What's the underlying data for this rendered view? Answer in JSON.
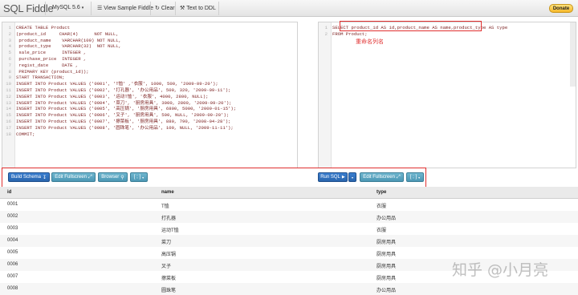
{
  "topbar": {
    "brand": "SQL Fiddle",
    "db_select": "MySQL 5.6",
    "view_sample": "View Sample Fiddle",
    "clear": "Clear",
    "text_to_ddl": "Text to DDL",
    "donate": "Donate"
  },
  "schema_lines": [
    "CREATE TABLE Product",
    "(product_id     CHAR(4)      NOT NULL,",
    " product_name    VARCHAR(100) NOT NULL,",
    " product_type    VARCHAR(32)  NOT NULL,",
    " sale_price      INTEGER ,",
    " purchase_price  INTEGER ,",
    " regist_date     DATE ,",
    " PRIMARY KEY (product_id));",
    "START TRANSACTION;",
    "INSERT INTO Product VALUES ('0001', 'T恤' ,'衣服', 1000, 500, '2009-09-20');",
    "INSERT INTO Product VALUES ('0002', '打孔器', '办公用品', 500, 320, '2009-09-11');",
    "INSERT INTO Product VALUES ('0003', '运动T恤', '衣服', 4000, 2800, NULL);",
    "INSERT INTO Product VALUES ('0004', '菜刀', '厨房用具', 3000, 2800, '2009-09-20');",
    "INSERT INTO Product VALUES ('0005', '高压锅', '厨房用具', 6800, 5000, '2009-01-15');",
    "INSERT INTO Product VALUES ('0006', '叉子', '厨房用具', 500, NULL, '2009-09-20');",
    "INSERT INTO Product VALUES ('0007', '擦菜板', '厨房用具', 880, 790, '2008-04-28');",
    "INSERT INTO Product VALUES ('0008', '圆珠笔', '办公用品', 100, NULL, '2009-11-11');",
    "COMMIT;"
  ],
  "query_lines": [
    "SELECT product_id AS id,product_name AS name,product_type AS type",
    "FROM Product;"
  ],
  "annotation": "重命名列名",
  "left_buttons": {
    "build": "Build Schema",
    "fullscreen": "Edit Fullscreen",
    "browser": "Browser",
    "sep": "[ ; ]"
  },
  "right_buttons": {
    "run": "Run SQL",
    "fullscreen": "Edit Fullscreen",
    "sep": "[ ; ]"
  },
  "results": {
    "columns": [
      "id",
      "name",
      "type"
    ],
    "rows": [
      [
        "0001",
        "T恤",
        "衣服"
      ],
      [
        "0002",
        "打孔器",
        "办公用品"
      ],
      [
        "0003",
        "运动T恤",
        "衣服"
      ],
      [
        "0004",
        "菜刀",
        "厨房用具"
      ],
      [
        "0005",
        "高压锅",
        "厨房用具"
      ],
      [
        "0006",
        "叉子",
        "厨房用具"
      ],
      [
        "0007",
        "擦菜板",
        "厨房用具"
      ],
      [
        "0008",
        "圆珠笔",
        "办公用品"
      ]
    ]
  },
  "watermark": "知乎 @小月亮"
}
